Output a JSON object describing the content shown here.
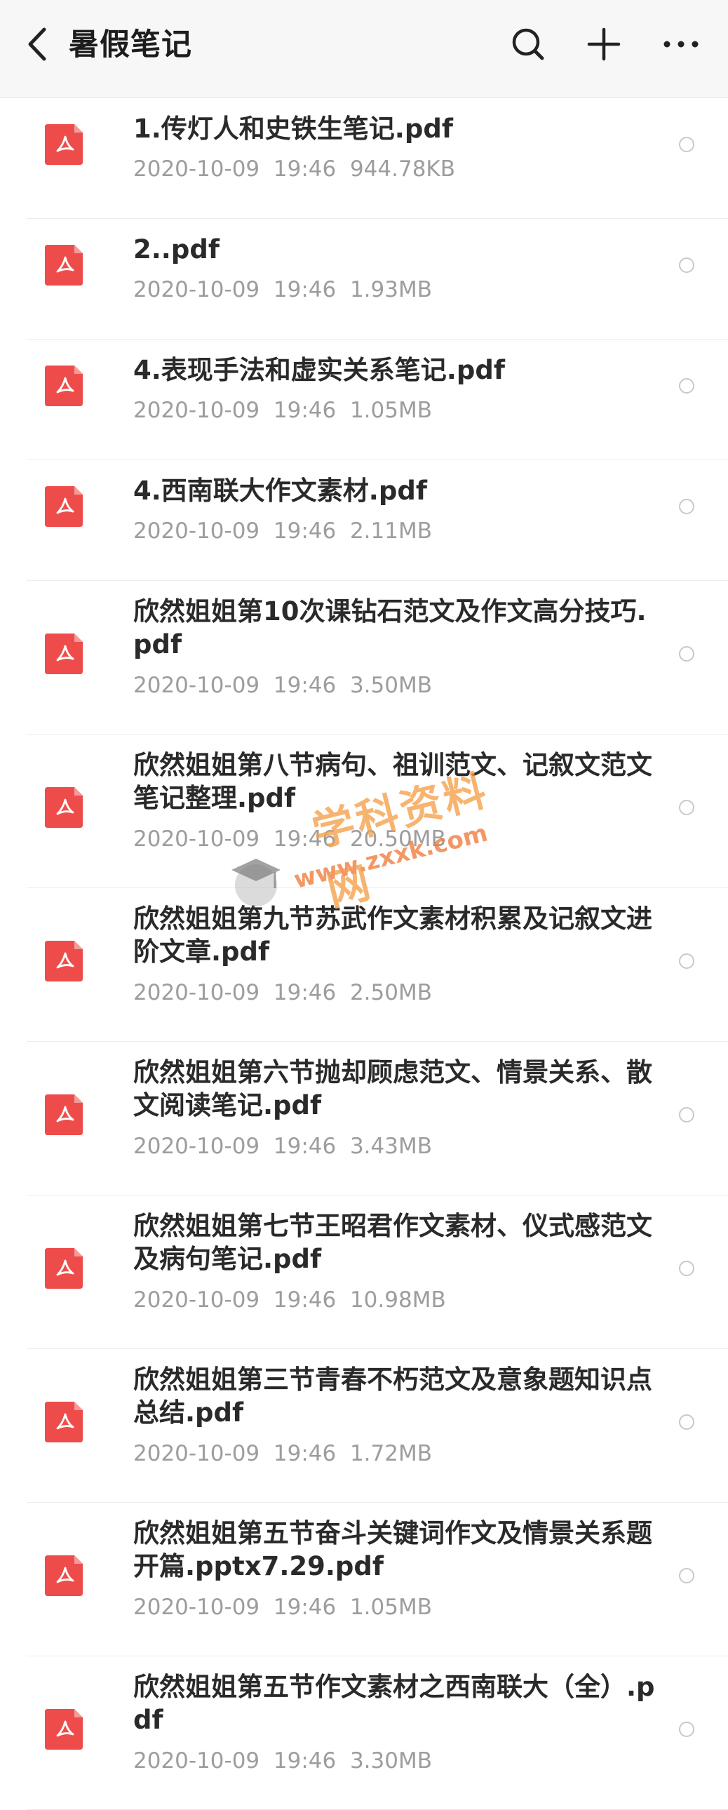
{
  "header": {
    "title": "暑假笔记",
    "back_icon": "chevron-left-icon",
    "search_icon": "search-icon",
    "add_icon": "plus-icon",
    "more_icon": "more-horizontal-icon"
  },
  "colors": {
    "pdf_red": "#ee4c4a",
    "meta_gray": "#9d9d9d",
    "title_dark": "#1d1d1d",
    "watermark_orange": "#f6a04a"
  },
  "files": [
    {
      "name": "1.传灯人和史铁生笔记.pdf",
      "date": "2020-10-09",
      "time": "19:46",
      "size": "944.78KB"
    },
    {
      "name": "2..pdf",
      "date": "2020-10-09",
      "time": "19:46",
      "size": "1.93MB"
    },
    {
      "name": "4.表现手法和虚实关系笔记.pdf",
      "date": "2020-10-09",
      "time": "19:46",
      "size": "1.05MB"
    },
    {
      "name": "4.西南联大作文素材.pdf",
      "date": "2020-10-09",
      "time": "19:46",
      "size": "2.11MB"
    },
    {
      "name": "欣然姐姐第10次课钻石范文及作文高分技巧.pdf",
      "date": "2020-10-09",
      "time": "19:46",
      "size": "3.50MB"
    },
    {
      "name": "欣然姐姐第八节病句、祖训范文、记叙文范文笔记整理.pdf",
      "date": "2020-10-09",
      "time": "19:46",
      "size": "20.50MB"
    },
    {
      "name": "欣然姐姐第九节苏武作文素材积累及记叙文进阶文章.pdf",
      "date": "2020-10-09",
      "time": "19:46",
      "size": "2.50MB"
    },
    {
      "name": "欣然姐姐第六节抛却顾虑范文、情景关系、散文阅读笔记.pdf",
      "date": "2020-10-09",
      "time": "19:46",
      "size": "3.43MB"
    },
    {
      "name": "欣然姐姐第七节王昭君作文素材、仪式感范文及病句笔记.pdf",
      "date": "2020-10-09",
      "time": "19:46",
      "size": "10.98MB"
    },
    {
      "name": "欣然姐姐第三节青春不朽范文及意象题知识点总结.pdf",
      "date": "2020-10-09",
      "time": "19:46",
      "size": "1.72MB"
    },
    {
      "name": "欣然姐姐第五节奋斗关键词作文及情景关系题开篇.pptx7.29.pdf",
      "date": "2020-10-09",
      "time": "19:46",
      "size": "1.05MB"
    },
    {
      "name": "欣然姐姐第五节作文素材之西南联大（全）.pdf",
      "date": "2020-10-09",
      "time": "19:46",
      "size": "3.30MB"
    }
  ],
  "watermark": {
    "text": "学科资料网",
    "url": "www.zxxk.com"
  }
}
